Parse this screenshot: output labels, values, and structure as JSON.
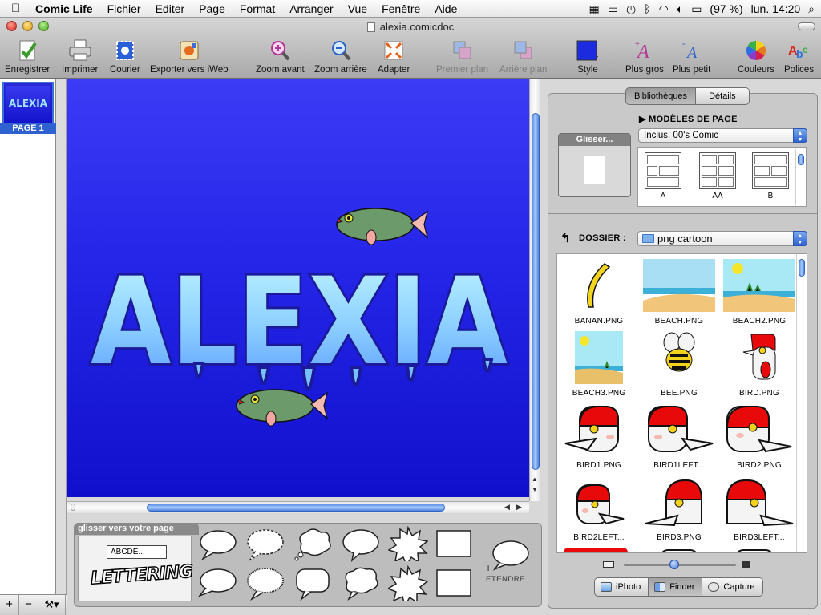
{
  "menubar": {
    "app_name": "Comic Life",
    "items": [
      "Fichier",
      "Editer",
      "Page",
      "Format",
      "Arranger",
      "Vue",
      "Fenêtre",
      "Aide"
    ],
    "battery": "(97 %)",
    "clock": "lun. 14:20"
  },
  "window": {
    "title": "alexia.comicdoc"
  },
  "toolbar": {
    "save": "Enregistrer",
    "print": "Imprimer",
    "mail": "Courier",
    "export": "Exporter vers iWeb",
    "zoom_in": "Zoom avant",
    "zoom_out": "Zoom arrière",
    "fit": "Adapter",
    "front": "Premier plan",
    "back": "Arrière plan",
    "style": "Style",
    "bigger": "Plus gros",
    "smaller": "Plus petit",
    "colors": "Couleurs",
    "fonts": "Polices"
  },
  "pages": {
    "thumb_text": "ALEXIA",
    "label": "PAGE 1"
  },
  "canvas": {
    "lettering_text": "ALEXIA"
  },
  "tray": {
    "title": "glisser vers votre page",
    "text_sample": "ABCDE...",
    "lettering_sample": "LETTERING",
    "expand_label": "ETENDRE"
  },
  "inspector": {
    "tabs": [
      "Bibliothèques",
      "Détails"
    ],
    "drag_label": "Glisser...",
    "templates_header": "MODÈLES DE PAGE",
    "templates_select": "Inclus: 00's Comic",
    "templates": [
      "A",
      "AA",
      "B"
    ],
    "folder_label": "DOSSIER :",
    "folder_select": "png cartoon",
    "files": [
      "BANAN.PNG",
      "BEACH.PNG",
      "BEACH2.PNG",
      "BEACH3.PNG",
      "BEE.PNG",
      "BIRD.PNG",
      "BIRD1.PNG",
      "BIRD1LEFT...",
      "BIRD2.PNG",
      "BIRD2LEFT...",
      "BIRD3.PNG",
      "BIRD3LEFT..."
    ],
    "source_tabs": [
      "iPhoto",
      "Finder",
      "Capture"
    ],
    "zoom_level": 0.45
  },
  "colors": {
    "canvas_top": "#3c3cf6",
    "canvas_bottom": "#1010cc",
    "accent": "#2f62d0",
    "bird_red": "#e80a0a"
  }
}
